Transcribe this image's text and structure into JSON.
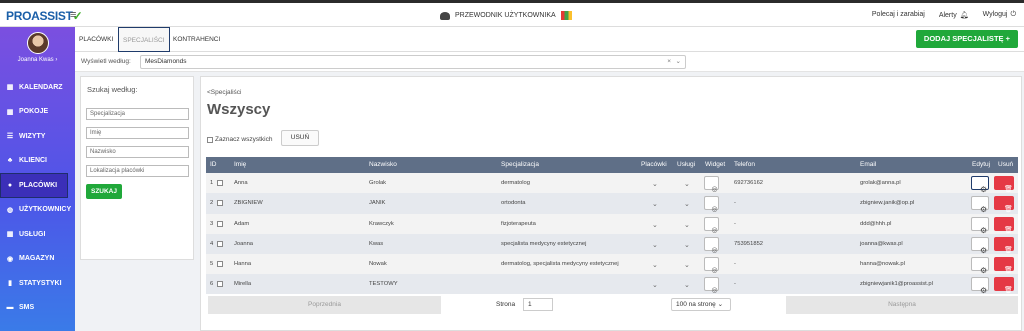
{
  "app": {
    "logo": "PROASSIST",
    "guide_label": "PRZEWODNIK UŻYTKOWNIKA"
  },
  "topbar": {
    "recommend": "Polecaj i zarabiaj",
    "alerts": "Alerty",
    "logout": "Wyloguj"
  },
  "user": {
    "name": "Joanna Kwas ›"
  },
  "sidebar": {
    "items": [
      {
        "label": "KALENDARZ",
        "icon": "calendar-icon",
        "glyph": "▦"
      },
      {
        "label": "POKOJE",
        "icon": "calendar-icon",
        "glyph": "▦"
      },
      {
        "label": "WIZYTY",
        "icon": "list-icon",
        "glyph": "☰"
      },
      {
        "label": "KLIENCI",
        "icon": "users-icon",
        "glyph": "♣"
      },
      {
        "label": "PLACÓWKI",
        "icon": "user-icon",
        "glyph": "●"
      },
      {
        "label": "UŻYTKOWNICY",
        "icon": "globe-icon",
        "glyph": "◍"
      },
      {
        "label": "USŁUGI",
        "icon": "grid-icon",
        "glyph": "▦"
      },
      {
        "label": "MAGAZYN",
        "icon": "box-icon",
        "glyph": "◉"
      },
      {
        "label": "STATYSTYKI",
        "icon": "bar-chart-icon",
        "glyph": "▮"
      },
      {
        "label": "SMS",
        "icon": "message-icon",
        "glyph": "▬"
      }
    ]
  },
  "tabs": [
    "PLACÓWKI",
    "SPECJALIŚCI",
    "KONTRAHENCI"
  ],
  "add_button": "DODAJ SPECJALISTĘ +",
  "filter": {
    "label": "Wyświetl według:",
    "value": "MesDiamonds"
  },
  "search": {
    "title": "Szukaj według:",
    "placeholders": [
      "Specjalizacja",
      "Imię",
      "Nazwisko",
      "Lokalizacja placówki"
    ],
    "button": "SZUKAJ"
  },
  "main": {
    "breadcrumb": "<Specjaliści",
    "title": "Wszyscy",
    "select_all": "Zaznacz wszystkich",
    "delete_label": "USUŃ"
  },
  "table": {
    "headers": {
      "id": "ID",
      "first": "Imię",
      "last": "Nazwisko",
      "spec": "Specjalizacja",
      "places": "Placówki",
      "services": "Usługi",
      "widget": "Widget",
      "phone": "Telefon",
      "email": "Email",
      "edit": "Edytuj",
      "remove": "Usuń"
    },
    "rows": [
      {
        "id": "1",
        "first": "Anna",
        "last": "Grolak",
        "spec": "dermatolog",
        "phone": "692736162",
        "email": "grolak@anna.pl"
      },
      {
        "id": "2",
        "first": "ZBIGNIEW",
        "last": "JANIK",
        "spec": "ortodonta",
        "phone": "-",
        "email": "zbigniew.janik@op.pl"
      },
      {
        "id": "3",
        "first": "Adam",
        "last": "Krawczyk",
        "spec": "fizjoterapeuta",
        "phone": "-",
        "email": "ddd@hhh.pl"
      },
      {
        "id": "4",
        "first": "Joanna",
        "last": "Kwas",
        "spec": "specjalista medycyny estetycznej",
        "phone": "753951852",
        "email": "joanna@kwas.pl"
      },
      {
        "id": "5",
        "first": "Hanna",
        "last": "Nowak",
        "spec": "dermatolog, specjalista medycyny estetycznej",
        "phone": "-",
        "email": "hanna@nowak.pl"
      },
      {
        "id": "6",
        "first": "Mirella",
        "last": "TESTOWY",
        "spec": "",
        "phone": "-",
        "email": "zbigniewjanik1@proassist.pl"
      }
    ]
  },
  "pager": {
    "prev": "Poprzednia",
    "page_label": "Strona",
    "page": "1",
    "page_size": "100 na stronę",
    "next": "Następna"
  }
}
